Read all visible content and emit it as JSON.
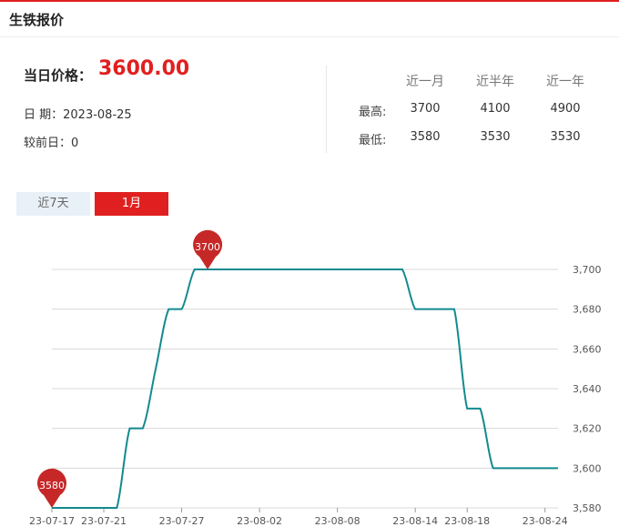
{
  "colors": {
    "accent": "#e02020",
    "line": "#138a8f",
    "marker": "#c62828",
    "tab_inactive_bg": "#e8f0f8",
    "grid": "#d8d8d8"
  },
  "header": {
    "title": "生铁报价"
  },
  "price": {
    "label": "当日价格：",
    "value": "3600.00"
  },
  "info": {
    "date": "日 期：2023-08-25",
    "change": "较前日：0"
  },
  "stats": {
    "columns": [
      "近一月",
      "近半年",
      "近一年"
    ],
    "rows": [
      {
        "label": "最高:",
        "values": [
          "3700",
          "4100",
          "4900"
        ]
      },
      {
        "label": "最低:",
        "values": [
          "3580",
          "3530",
          "3530"
        ]
      }
    ]
  },
  "tabs": [
    {
      "label": "近7天",
      "active": false
    },
    {
      "label": "1月",
      "active": true
    }
  ],
  "chart_data": {
    "type": "line",
    "x": [
      "2023-07-17",
      "2023-07-18",
      "2023-07-19",
      "2023-07-20",
      "2023-07-21",
      "2023-07-22",
      "2023-07-23",
      "2023-07-24",
      "2023-07-25",
      "2023-07-26",
      "2023-07-27",
      "2023-07-28",
      "2023-07-29",
      "2023-07-30",
      "2023-07-31",
      "2023-08-01",
      "2023-08-02",
      "2023-08-03",
      "2023-08-04",
      "2023-08-05",
      "2023-08-06",
      "2023-08-07",
      "2023-08-08",
      "2023-08-09",
      "2023-08-10",
      "2023-08-11",
      "2023-08-12",
      "2023-08-13",
      "2023-08-14",
      "2023-08-15",
      "2023-08-16",
      "2023-08-17",
      "2023-08-18",
      "2023-08-19",
      "2023-08-20",
      "2023-08-21",
      "2023-08-22",
      "2023-08-23",
      "2023-08-24",
      "2023-08-25"
    ],
    "values": [
      3580,
      3580,
      3580,
      3580,
      3580,
      3580,
      3620,
      3620,
      3650,
      3680,
      3680,
      3700,
      3700,
      3700,
      3700,
      3700,
      3700,
      3700,
      3700,
      3700,
      3700,
      3700,
      3700,
      3700,
      3700,
      3700,
      3700,
      3700,
      3680,
      3680,
      3680,
      3680,
      3630,
      3630,
      3600,
      3600,
      3600,
      3600,
      3600,
      3600
    ],
    "xtick_labels": [
      "23-07-17",
      "23-07-21",
      "23-07-27",
      "23-08-02",
      "23-08-08",
      "23-08-14",
      "23-08-18",
      "23-08-24"
    ],
    "xtick_dates": [
      "2023-07-17",
      "2023-07-21",
      "2023-07-27",
      "2023-08-02",
      "2023-08-08",
      "2023-08-14",
      "2023-08-18",
      "2023-08-24"
    ],
    "ytick_labels": [
      "3,580",
      "3,600",
      "3,620",
      "3,640",
      "3,660",
      "3,680",
      "3,700"
    ],
    "ylim": [
      3580,
      3700
    ],
    "grid": true,
    "markers": [
      {
        "label": "3580",
        "x": "2023-07-17",
        "value": 3580
      },
      {
        "label": "3700",
        "x": "2023-07-29",
        "value": 3700
      }
    ]
  }
}
